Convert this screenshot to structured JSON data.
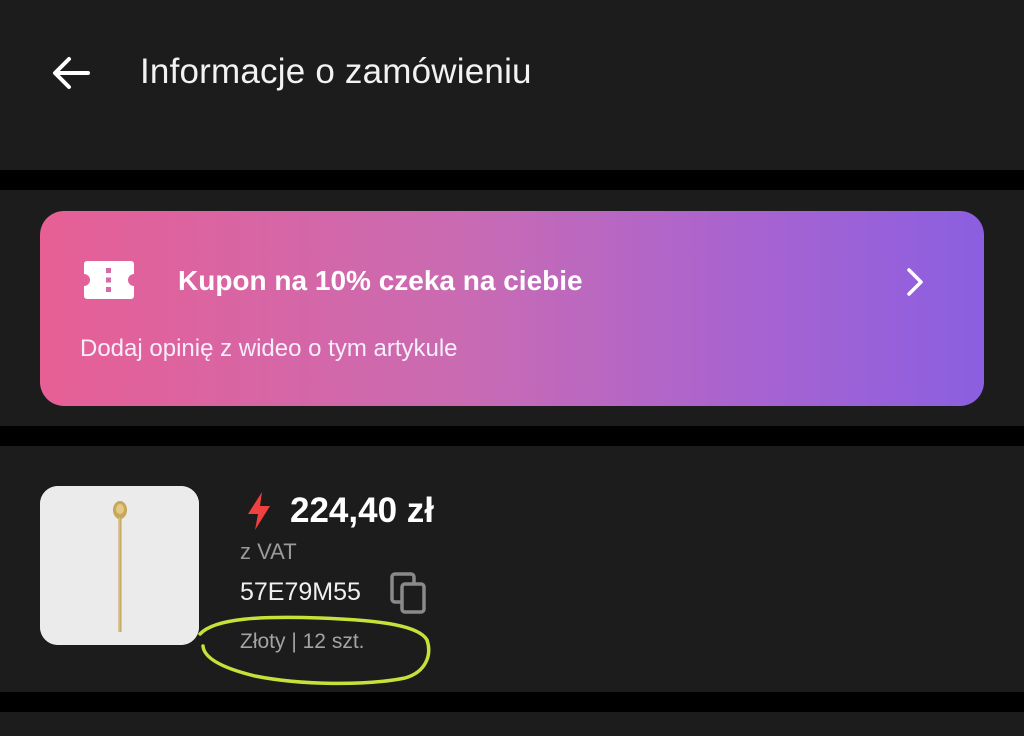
{
  "header": {
    "back_icon": "arrow-left-icon",
    "title": "Informacje o zamówieniu"
  },
  "coupon": {
    "icon": "ticket-icon",
    "title": "Kupon na 10% czeka na ciebie",
    "subtitle": "Dodaj opinię z wideo o tym artykule",
    "chevron_icon": "chevron-right-icon",
    "gradient_start": "#e75f95",
    "gradient_end": "#8b5fe0"
  },
  "product": {
    "image_icon": "gold-spoon-image",
    "price_icon": "lightning-bolt-icon",
    "price": "224,40 zł",
    "vat_label": "z VAT",
    "sku": "57E79M55",
    "copy_icon": "copy-icon",
    "variant": "Złoty | 12 szt.",
    "highlight_color": "#c8e03a",
    "accent_color": "#f04040"
  }
}
